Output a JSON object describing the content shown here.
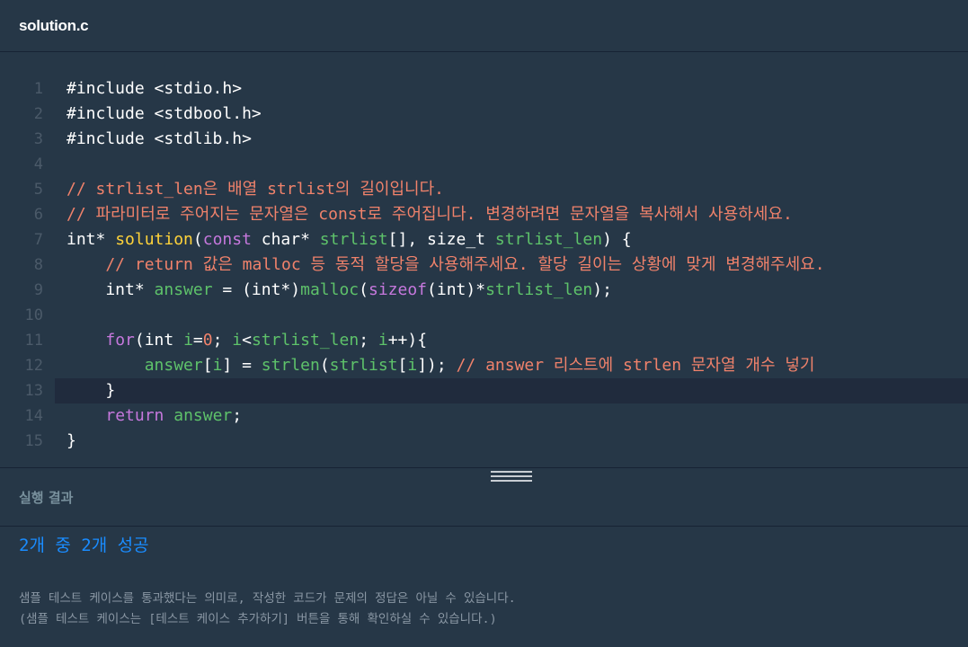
{
  "tab": {
    "filename": "solution.c"
  },
  "editor": {
    "active_line": 13,
    "lines": [
      {
        "n": "1"
      },
      {
        "n": "2"
      },
      {
        "n": "3"
      },
      {
        "n": "4"
      },
      {
        "n": "5"
      },
      {
        "n": "6"
      },
      {
        "n": "7"
      },
      {
        "n": "8"
      },
      {
        "n": "9"
      },
      {
        "n": "10"
      },
      {
        "n": "11"
      },
      {
        "n": "12"
      },
      {
        "n": "13"
      },
      {
        "n": "14"
      },
      {
        "n": "15"
      }
    ],
    "tokens": {
      "l1": "#include <stdio.h>",
      "l2": "#include <stdbool.h>",
      "l3": "#include <stdlib.h>",
      "l5": "// strlist_len은 배열 strlist의 길이입니다.",
      "l6": "// 파라미터로 주어지는 문자열은 const로 주어집니다. 변경하려면 문자열을 복사해서 사용하세요.",
      "l7a": "int* ",
      "l7b": "solution",
      "l7c": "(",
      "l7d": "const",
      "l7e": " char* ",
      "l7f": "strlist",
      "l7g": "[], size_t ",
      "l7h": "strlist_len",
      "l7i": ") {",
      "l8": "    // return 값은 malloc 등 동적 할당을 사용해주세요. 할당 길이는 상황에 맞게 변경해주세요.",
      "l9a": "    int* ",
      "l9b": "answer",
      "l9c": " = (int*)",
      "l9d": "malloc",
      "l9e": "(",
      "l9f": "sizeof",
      "l9g": "(int)*",
      "l9h": "strlist_len",
      "l9i": ");",
      "l11a": "    ",
      "l11b": "for",
      "l11c": "(int ",
      "l11d": "i",
      "l11e": "=",
      "l11f": "0",
      "l11g": "; ",
      "l11h": "i",
      "l11i": "<",
      "l11j": "strlist_len",
      "l11k": "; ",
      "l11l": "i",
      "l11m": "++){",
      "l12a": "        ",
      "l12b": "answer",
      "l12c": "[",
      "l12d": "i",
      "l12e": "] = ",
      "l12f": "strlen",
      "l12g": "(",
      "l12h": "strlist",
      "l12i": "[",
      "l12j": "i",
      "l12k": "]); ",
      "l12l": "// answer 리스트에 strlen 문자열 개수 넣기",
      "l13": "    }",
      "l14a": "    ",
      "l14b": "return",
      "l14c": " ",
      "l14d": "answer",
      "l14e": ";",
      "l15": "}"
    }
  },
  "results": {
    "title": "실행 결과",
    "summary": "2개 중 2개 성공",
    "note_line1": "샘플 테스트 케이스를 통과했다는 의미로, 작성한 코드가 문제의 정답은 아닐 수 있습니다.",
    "note_line2": "(샘플 테스트 케이스는 [테스트 케이스 추가하기] 버튼을 통해 확인하실 수 있습니다.)"
  },
  "colors": {
    "background": "#263747",
    "keyword": "#c678dd",
    "function": "#ffd33a",
    "identifier": "#5ec26a",
    "comment": "#f0826b",
    "success": "#1a8cff"
  }
}
